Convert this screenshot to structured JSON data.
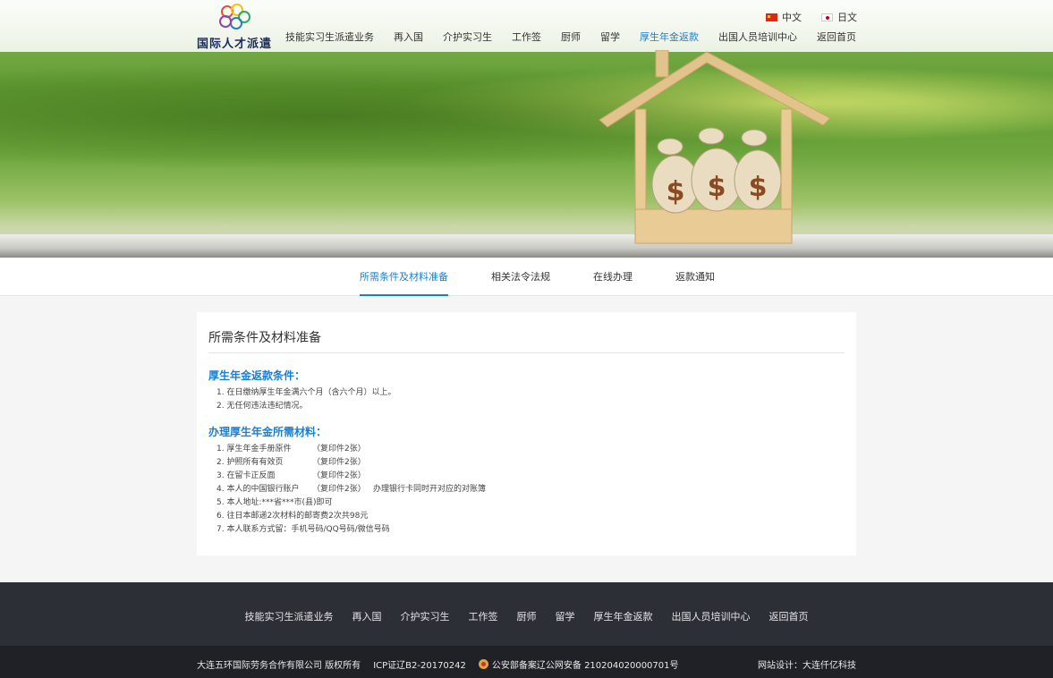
{
  "header": {
    "logo_text": "国际人才派遣",
    "languages": [
      {
        "label": "中文",
        "flag": "cn-flag-icon"
      },
      {
        "label": "日文",
        "flag": "jp-flag-icon"
      }
    ],
    "nav": [
      "技能实习生派遣业务",
      "再入国",
      "介护实习生",
      "工作签",
      "厨师",
      "留学",
      "厚生年金返款",
      "出国人员培训中心",
      "返回首页"
    ],
    "active_nav": "厚生年金返款"
  },
  "tabs": [
    "所需条件及材料准备",
    "相关法令法规",
    "在线办理",
    "返款通知"
  ],
  "active_tab": "所需条件及材料准备",
  "card": {
    "title": "所需条件及材料准备",
    "section1_title": "厚生年金返款条件：",
    "section1_items": [
      "1. 在日缴纳厚生年金满六个月（含六个月）以上。",
      "2. 无任何违法违纪情况。"
    ],
    "section2_title": "办理厚生年金所需材料：",
    "section2_items": [
      {
        "name": "1. 厚生年金手册原件",
        "note": "（复印件2张）",
        "extra": ""
      },
      {
        "name": "2. 护照所有有效页",
        "note": "（复印件2张）",
        "extra": ""
      },
      {
        "name": "3. 在留卡正反面",
        "note": "（复印件2张）",
        "extra": ""
      },
      {
        "name": "4. 本人的中国银行账户",
        "note": "（复印件2张）",
        "extra": "办理银行卡同时开对应的对账簿"
      },
      {
        "name": "5. 本人地址:***省***市(县)即可",
        "note": "",
        "extra": ""
      },
      {
        "name": "6. 往日本邮递2次材料的邮寄费2次共98元",
        "note": "",
        "extra": ""
      },
      {
        "name": "7. 本人联系方式留：手机号码/QQ号码/微信号码",
        "note": "",
        "extra": ""
      }
    ]
  },
  "footer": {
    "nav": [
      "技能实习生派遣业务",
      "再入国",
      "介护实习生",
      "工作签",
      "厨师",
      "留学",
      "厚生年金返款",
      "出国人员培训中心",
      "返回首页"
    ],
    "copyright": "大连五环国际劳务合作有限公司 版权所有",
    "icp": "ICP证辽B2-20170242",
    "police": "公安部备案辽公网安备 210204020000701号",
    "design": "网站设计：大连仟亿科技"
  },
  "colors": {
    "accent": "#1a7fd4",
    "footer_bg": "#2d2f36",
    "footer_bottom_bg": "#1f2127"
  }
}
